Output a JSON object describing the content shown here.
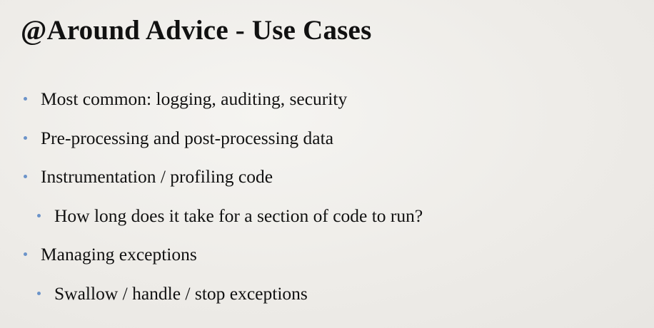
{
  "slide": {
    "title": "@Around Advice - Use Cases",
    "bullets": [
      {
        "text": "Most common: logging, auditing, security",
        "level": 1
      },
      {
        "text": "Pre-processing and post-processing data",
        "level": 1
      },
      {
        "text": "Instrumentation / profiling code",
        "level": 1
      },
      {
        "text": "How long does it take for a section of code to run?",
        "level": 2
      },
      {
        "text": "Managing exceptions",
        "level": 1
      },
      {
        "text": "Swallow / handle / stop exceptions",
        "level": 2
      }
    ],
    "bullet_color": "#6b93c9",
    "text_color": "#111111",
    "background_color": "#efedea"
  }
}
